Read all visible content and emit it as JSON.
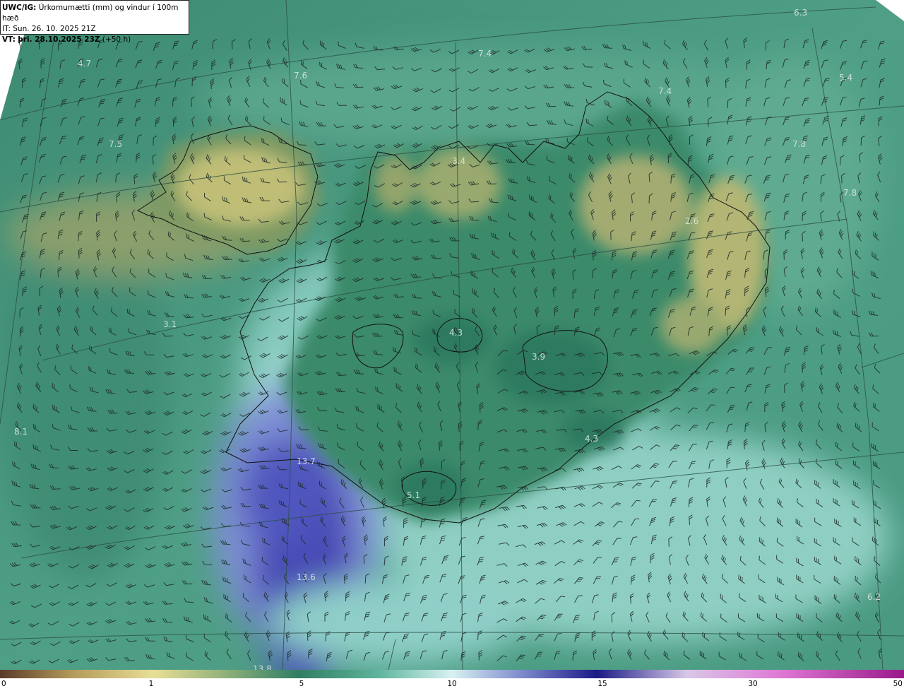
{
  "header": {
    "model_label": "UWC/IG:",
    "title": "Úrkomumætti (mm) og vindur í 100m hæð",
    "it_label": "IT:",
    "it_value": "Sun. 26. 10. 2025 21Z",
    "vt_label": "VT:",
    "vt_value": "þri. 28.10.2025 23Z",
    "lead": "(+50 h)"
  },
  "map_values": [
    {
      "name": "value-6-3",
      "text": "6.3"
    },
    {
      "name": "value-4-7",
      "text": "4.7"
    },
    {
      "name": "value-7-6",
      "text": "7.6"
    },
    {
      "name": "value-7-4-a",
      "text": "7.4"
    },
    {
      "name": "value-7-4-b",
      "text": "7.4"
    },
    {
      "name": "value-5-4",
      "text": "5.4"
    },
    {
      "name": "value-7-5",
      "text": "7.5"
    },
    {
      "name": "value-3-4",
      "text": "3.4"
    },
    {
      "name": "value-7-8-a",
      "text": "7.8"
    },
    {
      "name": "value-7-8-b",
      "text": "7.8"
    },
    {
      "name": "value-2-6",
      "text": "2.6"
    },
    {
      "name": "value-4-3-a",
      "text": "4.3"
    },
    {
      "name": "value-3-1",
      "text": "3.1"
    },
    {
      "name": "value-3-9",
      "text": "3.9"
    },
    {
      "name": "value-8-1",
      "text": "8.1"
    },
    {
      "name": "value-4-3-b",
      "text": "4.3"
    },
    {
      "name": "value-13-7",
      "text": "13.7"
    },
    {
      "name": "value-5-1",
      "text": "5.1"
    },
    {
      "name": "value-13-6",
      "text": "13.6"
    },
    {
      "name": "value-6-2",
      "text": "6.2"
    },
    {
      "name": "value-13-8",
      "text": "13.8"
    }
  ],
  "colorbar": {
    "ticks": [
      "0",
      "1",
      "5",
      "10",
      "15",
      "30",
      "50"
    ],
    "colors": [
      "#5a3a2a",
      "#b49a5a",
      "#e8df96",
      "#2f7e64",
      "#5fb59d",
      "#d8f2f2",
      "#7b86cc",
      "#1a1a86",
      "#e07ad6",
      "#9a1a8a"
    ]
  },
  "colors": {
    "sea_green": "#3f8f76",
    "land_yellow": "#c9c479",
    "heavy_blue": "#3b3ea8",
    "light_cyan": "#a9dcd8"
  }
}
